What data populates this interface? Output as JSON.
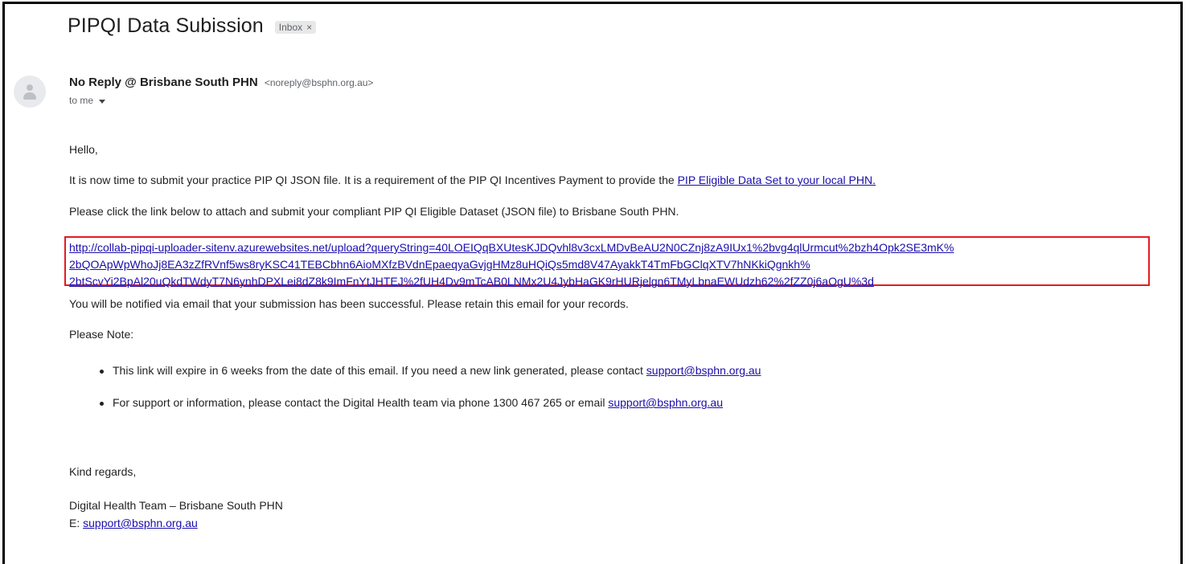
{
  "email": {
    "subject": "PIPQI Data Subission",
    "label": "Inbox",
    "label_remove": "×",
    "sender_name": "No Reply @ Brisbane South PHN",
    "sender_email": "<noreply@bsphn.org.au>",
    "recipient": "to me",
    "greeting": "Hello,",
    "para1_text": "It is now time to submit your practice PIP QI JSON file. It is a requirement of the PIP QI Incentives Payment to provide the ",
    "para1_link": "PIP Eligible Data Set to your local PHN.",
    "para2": "Please click the link below to attach and submit your compliant PIP QI Eligible Dataset (JSON file) to Brisbane South PHN.",
    "upload_link_lines": [
      "http://collab-pipqi-uploader-sitenv.azurewebsites.net/upload?queryString=40LOEIQqBXUtesKJDQvhl8v3cxLMDvBeAU2N0CZnj8zA9IUx1%2bvg4qlUrmcut%2bzh4Opk2SE3mK%",
      "2bQOApWpWhoJj8EA3zZfRVnf5ws8ryKSC41TEBCbhn6AioMXfzBVdnEpaeqyaGvjgHMz8uHQiQs5md8V47AyakkT4TmFbGClqXTV7hNKkiQgnkh%",
      "2btScvYi2BpAl20uQkdTWdyT7N6ynhDPXLei8dZ8k9ImFnYtJHTEJ%2fUH4Dv9mTcAB0LNMx2U4JybHaGK9rHURjelgn6TMyLbnaEWUdzh62%2fZZ0j6aOgU%3d"
    ],
    "para3": "You will be notified via email that your submission has been successful. Please retain this email for your records.",
    "note_heading": "Please Note:",
    "bullet1_text": "This link will expire in 6 weeks from the date of this email.  If you need a new link generated, please contact ",
    "bullet1_link": "support@bsphn.org.au",
    "bullet2_text": "For support or information, please contact the Digital Health team via phone 1300 467 265 or email ",
    "bullet2_link": "support@bsphn.org.au",
    "signoff": "Kind regards,",
    "signature_team": "Digital Health Team – Brisbane South PHN",
    "signature_email_prefix": "E: ",
    "signature_email": "support@bsphn.org.au"
  },
  "colors": {
    "link": "#1a0dab",
    "highlight_border": "#e31b23",
    "frame_border": "#000000"
  },
  "icons": {
    "avatar": "person-icon",
    "recipient_dropdown": "caret-down-icon"
  }
}
